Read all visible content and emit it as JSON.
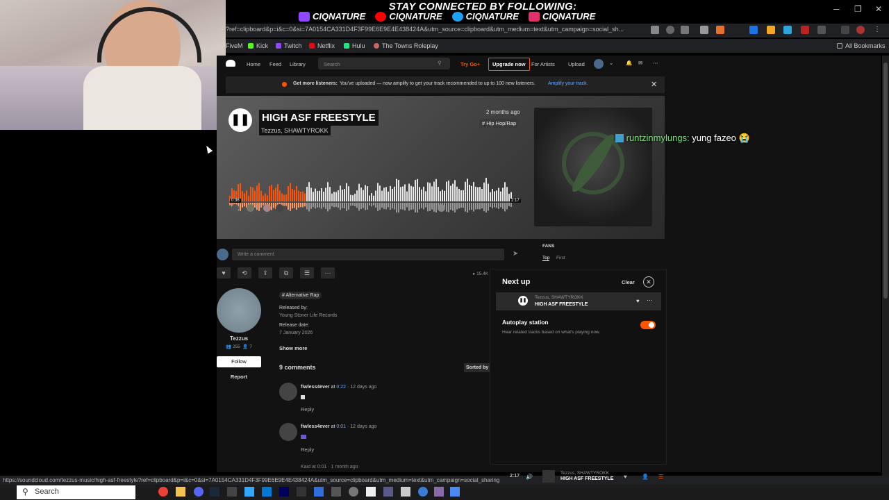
{
  "banner": {
    "title": "STAY CONNECTED BY FOLLOWING:",
    "socials": [
      "CIQNATURE",
      "CIQNATURE",
      "CIQNATURE",
      "CIQNATURE"
    ],
    "social_colors": [
      "#9146ff",
      "#ff0000",
      "#1da1f2",
      "#e1306c"
    ]
  },
  "window": {
    "min": "─",
    "restore": "❐",
    "close": "✕"
  },
  "address": {
    "url": "?ref=clipboard&p=i&c=0&si=7A0154CA331D4F3F99E6E9E4E438424A&utm_source=clipboard&utm_medium=text&utm_campaign=social_sh..."
  },
  "bookmarks": {
    "items": [
      {
        "label": "FiveM",
        "color": "#f28c28"
      },
      {
        "label": "Kick",
        "color": "#53fc18"
      },
      {
        "label": "Twitch",
        "color": "#9146ff"
      },
      {
        "label": "Netflix",
        "color": "#e50914"
      },
      {
        "label": "Hulu",
        "color": "#1ce783"
      },
      {
        "label": "The Towns Roleplay",
        "color": "#cc6666"
      }
    ],
    "all": "All Bookmarks"
  },
  "sc_nav": {
    "home": "Home",
    "feed": "Feed",
    "library": "Library",
    "search_placeholder": "Search",
    "trygo": "Try Go+",
    "upgrade": "Upgrade now",
    "for_artists": "For Artists",
    "upload": "Upload"
  },
  "promo": {
    "bold": "Get more listeners:",
    "text": "You've uploaded — now amplify to get your track recommended to up to 100 new listeners.",
    "link": "Amplify your track."
  },
  "track": {
    "title": "HIGH ASF FREESTYLE",
    "artists": "Tezzus, SHAWTYROKK",
    "posted": "2 months ago",
    "tag": "# Hip Hop/Rap",
    "time_current": "0:36",
    "time_total": "2:17",
    "plays": "15.4K"
  },
  "chat": {
    "user": "runtzinmylungs:",
    "message": "yung fazeo 😭"
  },
  "comment": {
    "placeholder": "Write a comment"
  },
  "fans": {
    "label": "FANS",
    "tab_top": "Top",
    "tab_first": "First"
  },
  "artist": {
    "name": "Tezzus",
    "followers": "255",
    "following": "7",
    "follow": "Follow",
    "report": "Report"
  },
  "meta": {
    "genre": "# Alternative Rap",
    "released_by_label": "Released by:",
    "released_by": "Young Stoner Life Records",
    "release_date_label": "Release date:",
    "release_date": "7 January 2026",
    "show_more": "Show more"
  },
  "comments": {
    "count": "9 comments",
    "sorted": "Sorted by",
    "items": [
      {
        "user": "fiwless4ever",
        "at": "at",
        "time": "0:22",
        "ago": "· 12 days ago",
        "reply": "Reply"
      },
      {
        "user": "fiwless4ever",
        "at": "at",
        "time": "0:01",
        "ago": "· 12 days ago",
        "reply": "Reply"
      }
    ],
    "partial": "Kaid at 0:01 · 1 month ago"
  },
  "next_up": {
    "title": "Next up",
    "clear": "Clear",
    "item_artist": "Tezzus, SHAWTYROKK",
    "item_title": "HIGH ASF FREESTYLE",
    "autoplay": "Autoplay station",
    "autoplay_desc": "Hear related tracks based on what's playing now."
  },
  "player": {
    "time": "2:17",
    "artist": "Tezzus, SHAWTYROKK",
    "title": "HIGH ASF FREESTYLE"
  },
  "status": {
    "url": "https://soundcloud.com/tezzus-music/high-asf-freestyle?ref=clipboard&p=i&c=0&si=7A0154CA331D4F3F99E6E9E4E438424A&utm_source=clipboard&utm_medium=text&utm_campaign=social_sharing"
  },
  "taskbar": {
    "search": "Search"
  },
  "accent": "#ff5500"
}
